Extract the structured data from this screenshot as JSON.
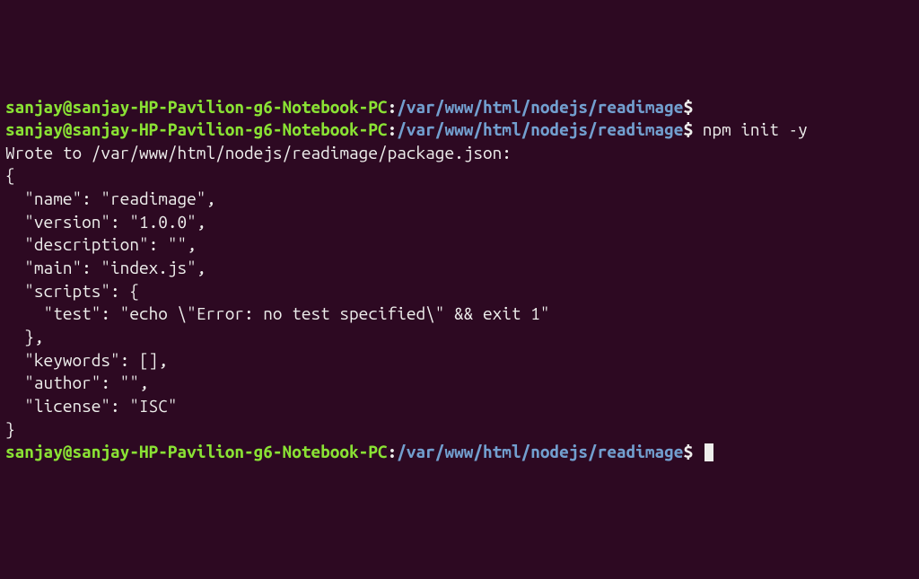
{
  "prompt": {
    "userhost": "sanjay@sanjay-HP-Pavilion-g6-Notebook-PC",
    "sep1": ":",
    "path": "/var/www/html/nodejs/readimage",
    "sep2": "$"
  },
  "lines": {
    "cmd1": "",
    "cmd2": " npm init -y",
    "out1": "Wrote to /var/www/html/nodejs/readimage/package.json:",
    "blank1": "",
    "json1": "{",
    "json2": "  \"name\": \"readimage\",",
    "json3": "  \"version\": \"1.0.0\",",
    "json4": "  \"description\": \"\",",
    "json5": "  \"main\": \"index.js\",",
    "json6": "  \"scripts\": {",
    "json7": "    \"test\": \"echo \\\"Error: no test specified\\\" && exit 1\"",
    "json8": "  },",
    "json9": "  \"keywords\": [],",
    "json10": "  \"author\": \"\",",
    "json11": "  \"license\": \"ISC\"",
    "json12": "}",
    "blank2": "",
    "blank3": ""
  }
}
